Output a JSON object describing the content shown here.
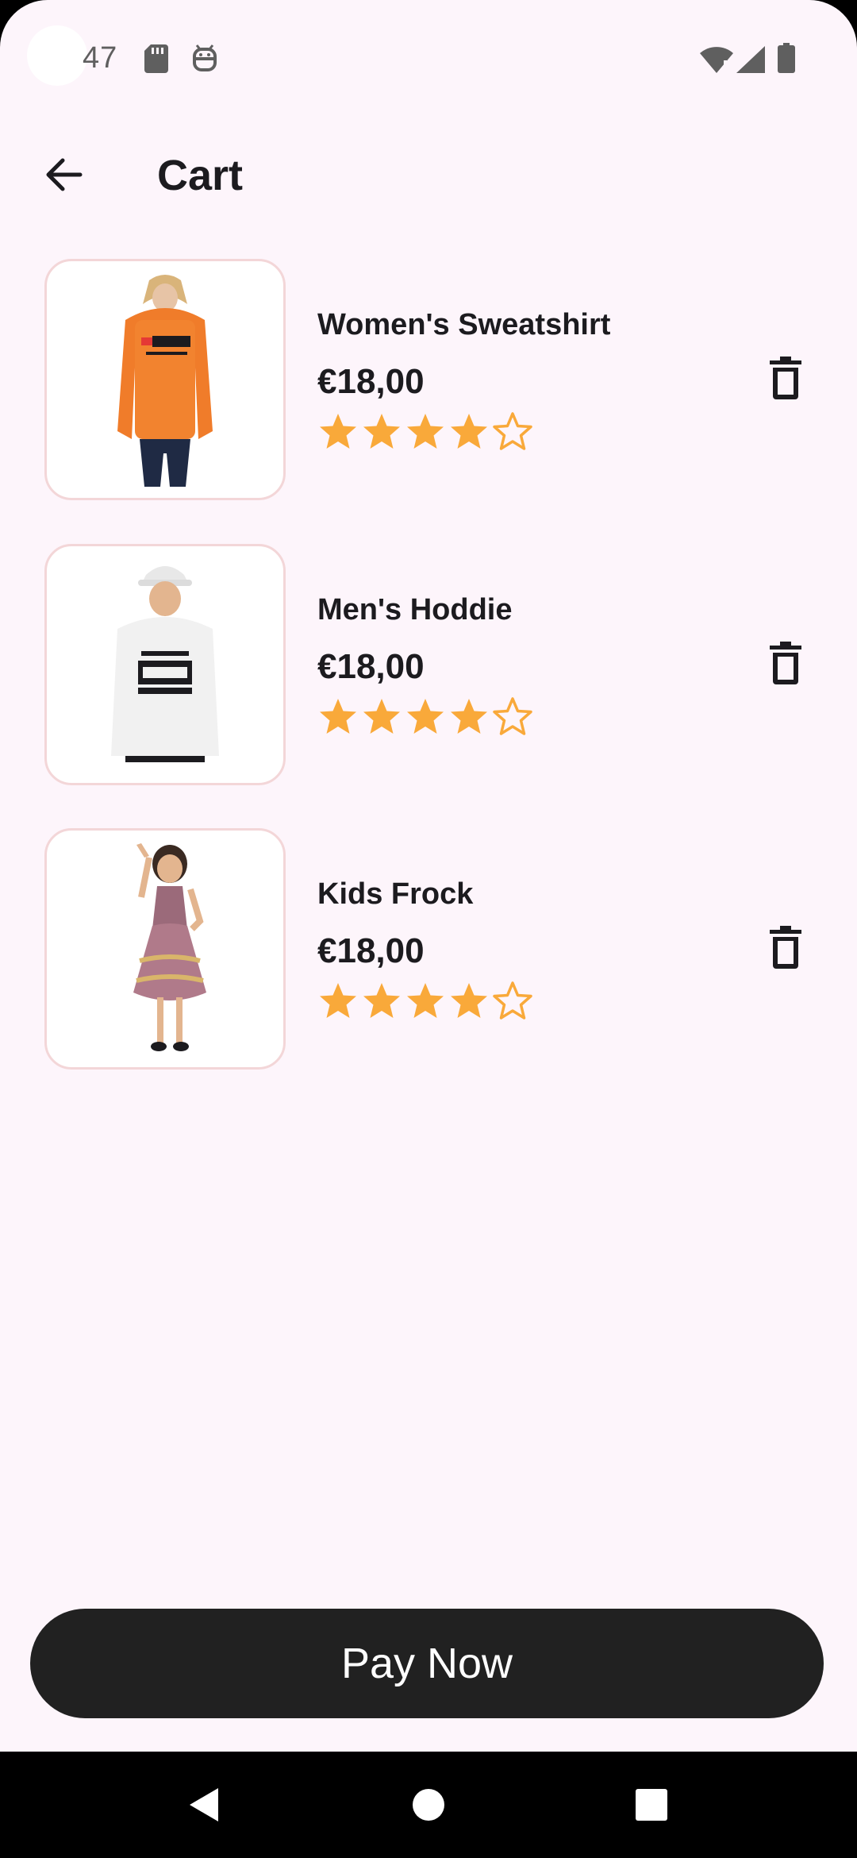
{
  "status_bar": {
    "time": "47",
    "icons": [
      "sd-card-icon",
      "android-debug-icon",
      "wifi-icon",
      "signal-icon",
      "battery-icon"
    ]
  },
  "app_bar": {
    "back_icon": "arrow-back-icon",
    "title": "Cart"
  },
  "cart": {
    "items": [
      {
        "name": "Women's Sweatshirt",
        "price": "€18,00",
        "rating": 4,
        "max_rating": 5,
        "image": "orange-hoodie-image",
        "delete_icon": "trash-icon"
      },
      {
        "name": "Men's Hoddie",
        "price": "€18,00",
        "rating": 4,
        "max_rating": 5,
        "image": "white-hoodie-image",
        "delete_icon": "trash-icon"
      },
      {
        "name": "Kids Frock",
        "price": "€18,00",
        "rating": 4,
        "max_rating": 5,
        "image": "kids-frock-image",
        "delete_icon": "trash-icon"
      }
    ]
  },
  "pay_button": {
    "label": "Pay Now"
  },
  "nav_bar": {
    "icons": [
      "back-triangle-icon",
      "home-circle-icon",
      "recents-square-icon"
    ]
  },
  "colors": {
    "background": "#FDF5FB",
    "star": "#F9A93A",
    "thumb_border": "#F3D6D8",
    "button": "#212121",
    "text": "#1c1b1f"
  }
}
